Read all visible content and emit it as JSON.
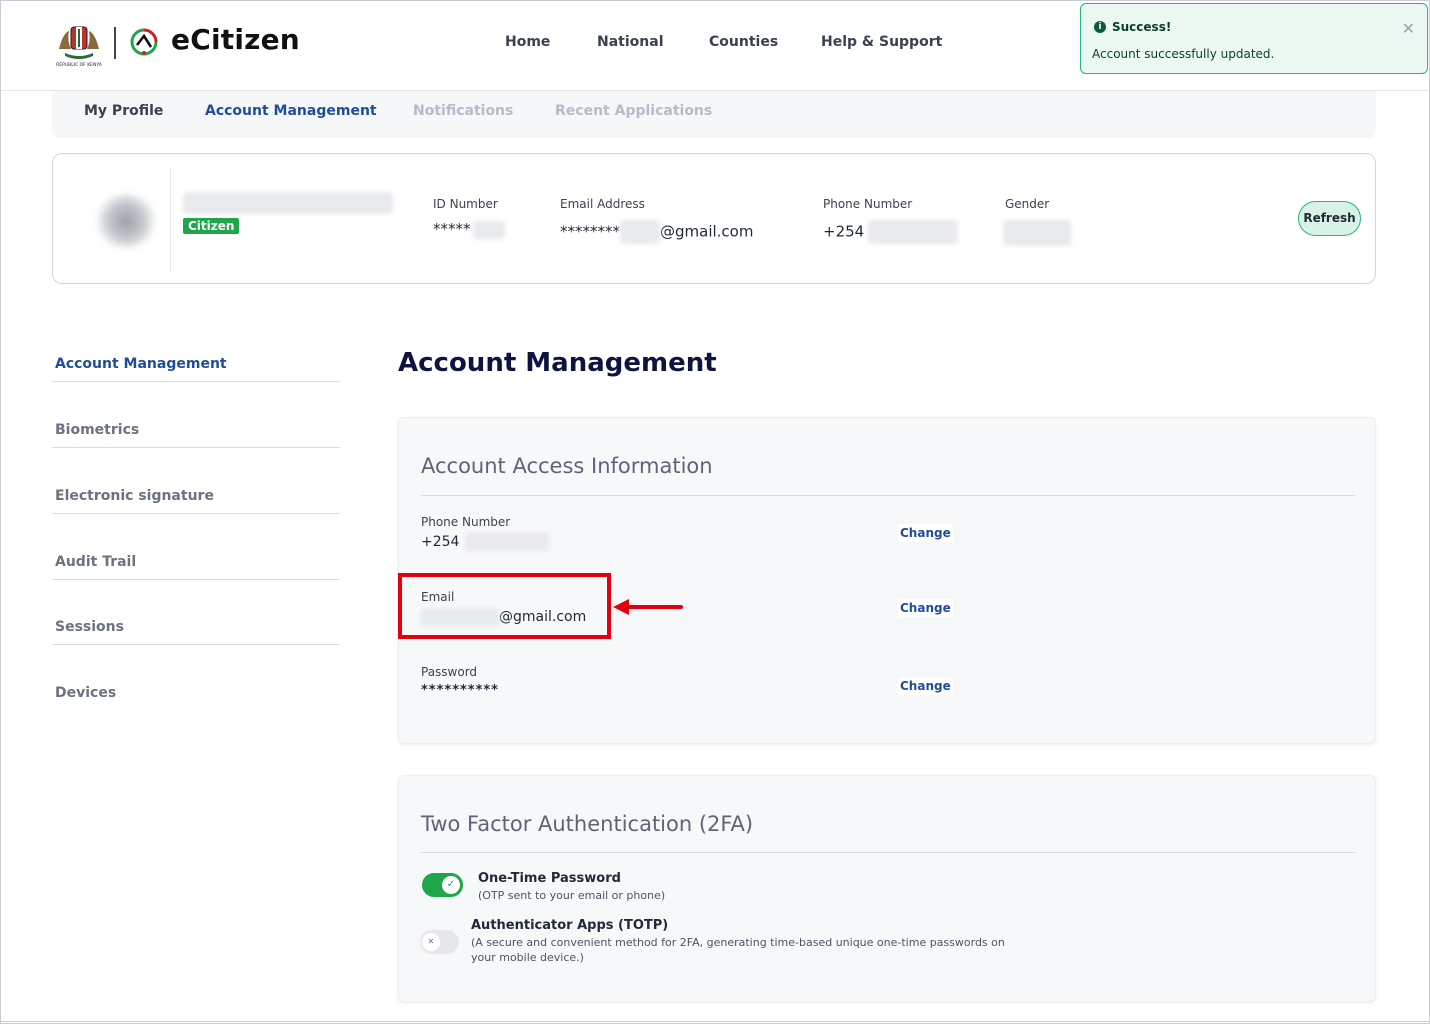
{
  "brand": {
    "name": "eCitizen",
    "crest_caption": "REPUBLIC OF KENYA"
  },
  "nav": {
    "items": [
      "Home",
      "National",
      "Counties",
      "Help & Support"
    ]
  },
  "toast": {
    "title": "Success!",
    "message": "Account successfully updated.",
    "close_icon": "close-icon",
    "color": "#2ab27b"
  },
  "tabs": [
    {
      "label": "My Profile",
      "state": "normal"
    },
    {
      "label": "Account Management",
      "state": "active"
    },
    {
      "label": "Notifications",
      "state": "disabled"
    },
    {
      "label": "Recent Applications",
      "state": "disabled"
    }
  ],
  "profile": {
    "badge": "Citizen",
    "id_label": "ID Number",
    "id_value": "*****",
    "email_label": "Email Address",
    "email_prefix": "********",
    "email_suffix": "@gmail.com",
    "phone_label": "Phone Number",
    "phone_prefix": "+254",
    "gender_label": "Gender",
    "refresh_label": "Refresh"
  },
  "sidebar": {
    "items": [
      "Account Management",
      "Biometrics",
      "Electronic signature",
      "Audit Trail",
      "Sessions",
      "Devices"
    ],
    "active": "Account Management"
  },
  "main": {
    "title": "Account Management",
    "access": {
      "title": "Account Access Information",
      "phone_label": "Phone Number",
      "phone_value": "+254",
      "email_label": "Email",
      "email_suffix": "@gmail.com",
      "password_label": "Password",
      "password_value": "**********",
      "change_label": "Change"
    },
    "twofa": {
      "title": "Two Factor Authentication (2FA)",
      "otp_title": "One-Time Password",
      "otp_desc": "(OTP sent to your email or phone)",
      "otp_enabled": true,
      "totp_title": "Authenticator Apps (TOTP)",
      "totp_desc": "(A secure and convenient method for 2FA, generating time-based unique one-time passwords on your mobile device.)",
      "totp_enabled": false
    }
  },
  "colors": {
    "accent": "#1f4d9c",
    "success": "#1fa64a",
    "highlight": "#e3000f",
    "title": "#0e1440"
  }
}
